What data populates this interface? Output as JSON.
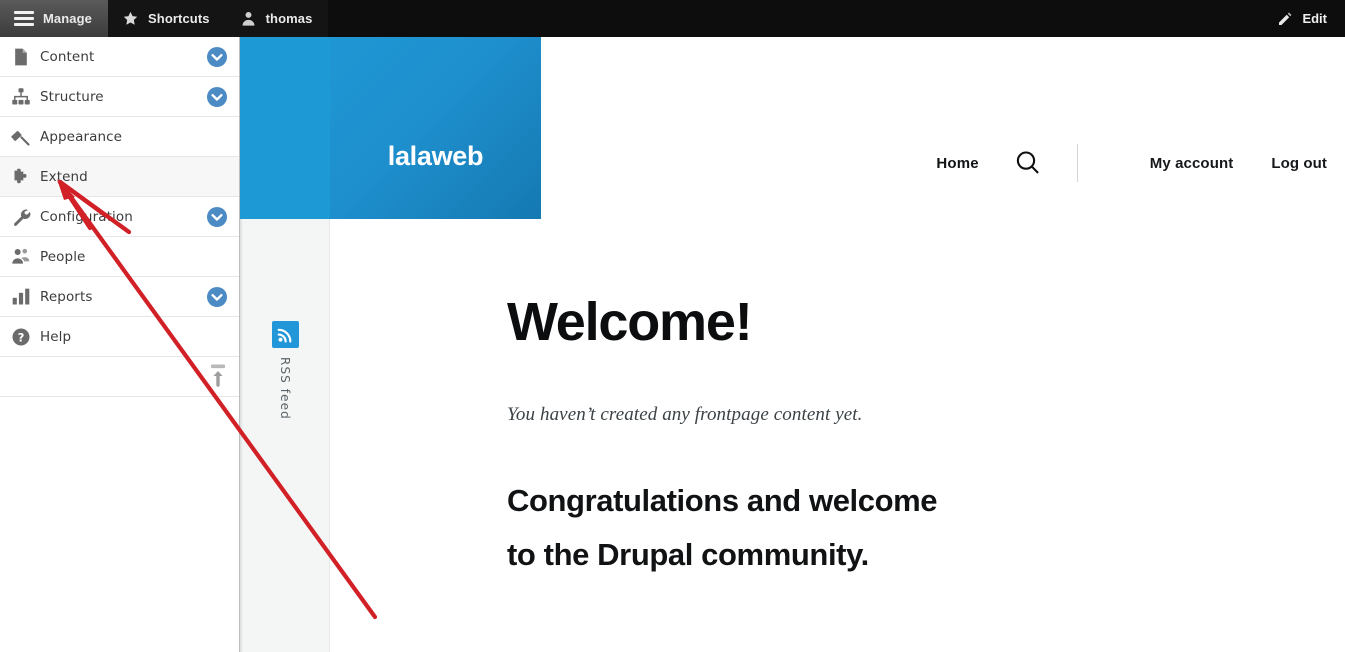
{
  "toolbar": {
    "manage_label": "Manage",
    "manage_icon": "hamburger-icon",
    "shortcuts_label": "Shortcuts",
    "shortcuts_icon": "star-icon",
    "account_label": "thomas",
    "account_icon": "user-icon",
    "edit_label": "Edit",
    "edit_icon": "pencil-icon",
    "background_color": "#0d0d0d",
    "active_tab_color": "#4a4a4a"
  },
  "tray": {
    "items": [
      {
        "label": "Content",
        "icon": "document-icon",
        "has_chevron": true,
        "hovered": false
      },
      {
        "label": "Structure",
        "icon": "sitemap-icon",
        "has_chevron": true,
        "hovered": false
      },
      {
        "label": "Appearance",
        "icon": "paint-roller-icon",
        "has_chevron": false,
        "hovered": false
      },
      {
        "label": "Extend",
        "icon": "puzzle-piece-icon",
        "has_chevron": false,
        "hovered": true
      },
      {
        "label": "Configuration",
        "icon": "wrench-icon",
        "has_chevron": true,
        "hovered": false
      },
      {
        "label": "People",
        "icon": "people-icon",
        "has_chevron": false,
        "hovered": false
      },
      {
        "label": "Reports",
        "icon": "bar-chart-icon",
        "has_chevron": true,
        "hovered": false
      },
      {
        "label": "Help",
        "icon": "question-mark-icon",
        "has_chevron": false,
        "hovered": false
      }
    ],
    "orientation_toggle_icon": "vertical-orientation-icon",
    "chevron_color": "#4c8bc4"
  },
  "site": {
    "logo_text": "lalaweb",
    "banner_light_color": "#1d9ad6",
    "banner_dark_color": "#1579b2",
    "rss": {
      "label": "RSS feed",
      "icon": "rss-icon",
      "icon_color": "#2196d8"
    },
    "nav": {
      "home_label": "Home",
      "search_icon": "search-icon",
      "my_account_label": "My account",
      "log_out_label": "Log out"
    },
    "content": {
      "title": "Welcome!",
      "note": "You haven’t created any frontpage content yet.",
      "congrats_line1": "Congratulations and welcome",
      "congrats_line2": "to the Drupal community."
    }
  },
  "annotation": {
    "arrow_color": "#d12026",
    "target_label": "Extend"
  }
}
